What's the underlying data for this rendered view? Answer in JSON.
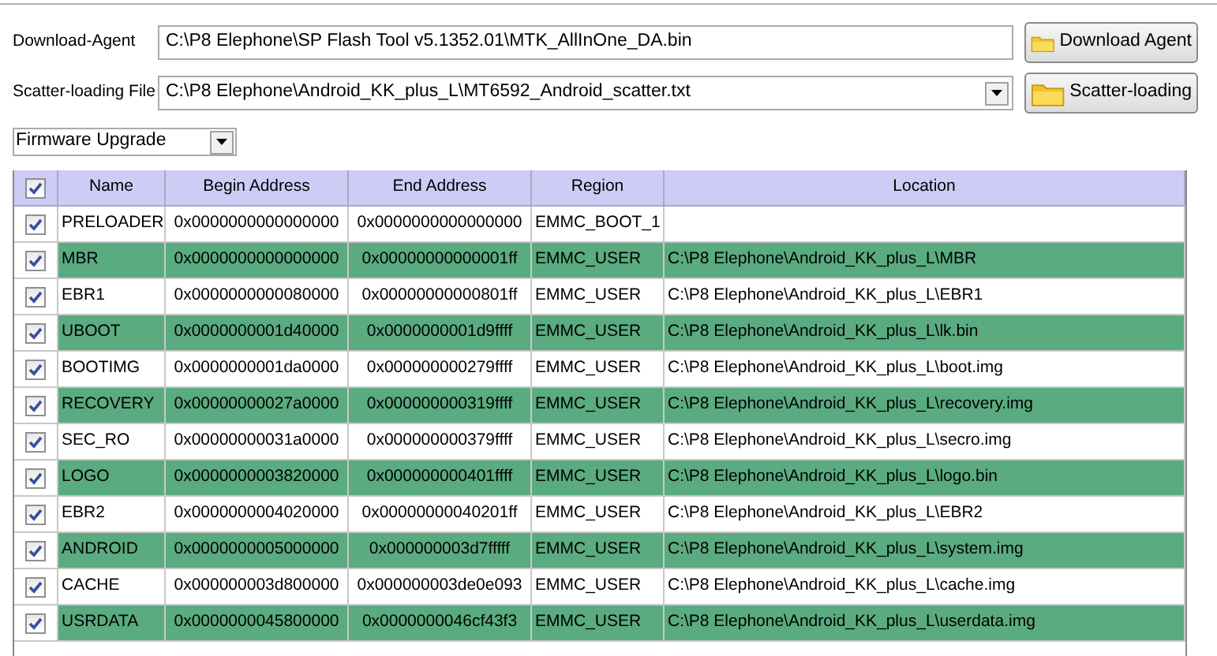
{
  "download_agent": {
    "label": "Download-Agent",
    "value": "C:\\P8 Elephone\\SP Flash Tool v5.1352.01\\MTK_AllInOne_DA.bin",
    "button": "Download Agent"
  },
  "scatter": {
    "label": "Scatter-loading File",
    "value": "C:\\P8 Elephone\\Android_KK_plus_L\\MT6592_Android_scatter.txt",
    "button": "Scatter-loading"
  },
  "mode": {
    "value": "Firmware Upgrade"
  },
  "table": {
    "all_checked": true,
    "columns": [
      "Name",
      "Begin Address",
      "End Address",
      "Region",
      "Location"
    ],
    "rows": [
      {
        "checked": true,
        "cells": [
          "PRELOADER",
          "0x0000000000000000",
          "0x0000000000000000",
          "EMMC_BOOT_1",
          ""
        ]
      },
      {
        "checked": true,
        "cells": [
          "MBR",
          "0x0000000000000000",
          "0x00000000000001ff",
          "EMMC_USER",
          "C:\\P8 Elephone\\Android_KK_plus_L\\MBR"
        ]
      },
      {
        "checked": true,
        "cells": [
          "EBR1",
          "0x0000000000080000",
          "0x00000000000801ff",
          "EMMC_USER",
          "C:\\P8 Elephone\\Android_KK_plus_L\\EBR1"
        ]
      },
      {
        "checked": true,
        "cells": [
          "UBOOT",
          "0x0000000001d40000",
          "0x0000000001d9ffff",
          "EMMC_USER",
          "C:\\P8 Elephone\\Android_KK_plus_L\\lk.bin"
        ]
      },
      {
        "checked": true,
        "cells": [
          "BOOTIMG",
          "0x0000000001da0000",
          "0x000000000279ffff",
          "EMMC_USER",
          "C:\\P8 Elephone\\Android_KK_plus_L\\boot.img"
        ]
      },
      {
        "checked": true,
        "cells": [
          "RECOVERY",
          "0x00000000027a0000",
          "0x000000000319ffff",
          "EMMC_USER",
          "C:\\P8 Elephone\\Android_KK_plus_L\\recovery.img"
        ]
      },
      {
        "checked": true,
        "cells": [
          "SEC_RO",
          "0x00000000031a0000",
          "0x000000000379ffff",
          "EMMC_USER",
          "C:\\P8 Elephone\\Android_KK_plus_L\\secro.img"
        ]
      },
      {
        "checked": true,
        "cells": [
          "LOGO",
          "0x0000000003820000",
          "0x000000000401ffff",
          "EMMC_USER",
          "C:\\P8 Elephone\\Android_KK_plus_L\\logo.bin"
        ]
      },
      {
        "checked": true,
        "cells": [
          "EBR2",
          "0x0000000004020000",
          "0x00000000040201ff",
          "EMMC_USER",
          "C:\\P8 Elephone\\Android_KK_plus_L\\EBR2"
        ]
      },
      {
        "checked": true,
        "cells": [
          "ANDROID",
          "0x0000000005000000",
          "0x000000003d7fffff",
          "EMMC_USER",
          "C:\\P8 Elephone\\Android_KK_plus_L\\system.img"
        ]
      },
      {
        "checked": true,
        "cells": [
          "CACHE",
          "0x000000003d800000",
          "0x000000003de0e093",
          "EMMC_USER",
          "C:\\P8 Elephone\\Android_KK_plus_L\\cache.img"
        ]
      },
      {
        "checked": true,
        "cells": [
          "USRDATA",
          "0x0000000045800000",
          "0x0000000046cf43f3",
          "EMMC_USER",
          "C:\\P8 Elephone\\Android_KK_plus_L\\userdata.img"
        ]
      }
    ]
  }
}
